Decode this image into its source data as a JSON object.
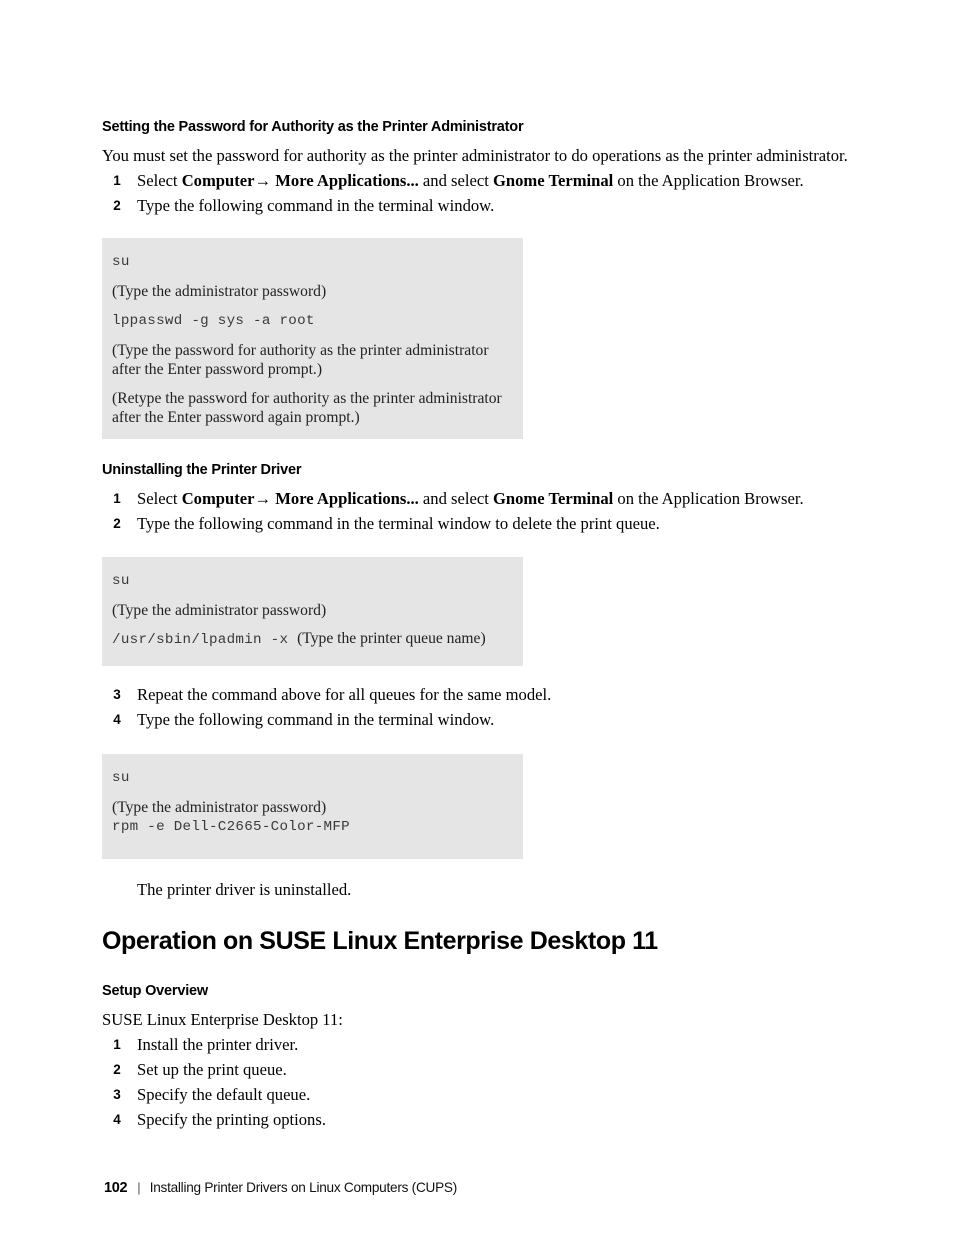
{
  "document": {
    "section_heading_1": "Setting the Password for Authority as the Printer Administrator",
    "intro_paragraph": "You must set the password for authority as the printer administrator to do operations as the printer administrator.",
    "section_heading_2": "Uninstalling the Printer Driver",
    "main_heading": "Operation on SUSE Linux Enterprise Desktop 11",
    "section_heading_3": "Setup Overview",
    "suse_intro": "SUSE Linux Enterprise Desktop 11:",
    "uninstall_result": "The printer driver is uninstalled."
  },
  "steps_password": [
    {
      "num": "1",
      "pre": "Select ",
      "bold1": "Computer→ More Applications...",
      "mid": " and select ",
      "bold2": "Gnome Terminal",
      "post": " on the Application Browser."
    },
    {
      "num": "2",
      "pre": "Type the following command in the terminal window.",
      "bold1": "",
      "mid": "",
      "bold2": "",
      "post": ""
    }
  ],
  "steps_uninstall": [
    {
      "num": "1",
      "pre": "Select ",
      "bold1": "Computer→ More Applications...",
      "mid": " and select ",
      "bold2": "Gnome Terminal",
      "post": " on the Application Browser."
    },
    {
      "num": "2",
      "pre": "Type the following command in the terminal window to delete the print queue.",
      "bold1": "",
      "mid": "",
      "bold2": "",
      "post": ""
    }
  ],
  "steps_uninstall_cont": [
    {
      "num": "3",
      "pre": "Repeat the command above for all queues for the same model.",
      "bold1": "",
      "mid": "",
      "bold2": "",
      "post": ""
    },
    {
      "num": "4",
      "pre": "Type the following command in the terminal window.",
      "bold1": "",
      "mid": "",
      "bold2": "",
      "post": ""
    }
  ],
  "steps_setup": [
    {
      "num": "1",
      "label": "Install the printer driver."
    },
    {
      "num": "2",
      "label": "Set up the print queue."
    },
    {
      "num": "3",
      "label": "Specify the default queue."
    },
    {
      "num": "4",
      "label": "Specify the printing options."
    }
  ],
  "codebox1": {
    "line1_cmd": "su",
    "line2_note": "(Type the administrator password)",
    "line3_cmd": "lppasswd -g sys -a root",
    "line4_note": "(Type the password for authority as the printer administrator after the Enter password prompt.)",
    "line5_note": "(Retype the password for authority as the printer administrator after the Enter password again prompt.)"
  },
  "codebox2": {
    "line1_cmd": "su",
    "line2_note": "(Type the administrator password)",
    "line3_cmd": "/usr/sbin/lpadmin -x ",
    "line3_note": "(Type the printer queue name)"
  },
  "codebox3": {
    "line1_cmd": "su",
    "line2_note": "(Type the administrator password)",
    "line3_cmd": "rpm -e Dell-C2665-Color-MFP"
  },
  "footer": {
    "page_number": "102",
    "separator": "|",
    "title": "Installing Printer Drivers on Linux Computers (CUPS)"
  },
  "colors": {
    "code_background": "#e5e5e5",
    "text": "#000000",
    "code_text": "#3a3a3a"
  }
}
